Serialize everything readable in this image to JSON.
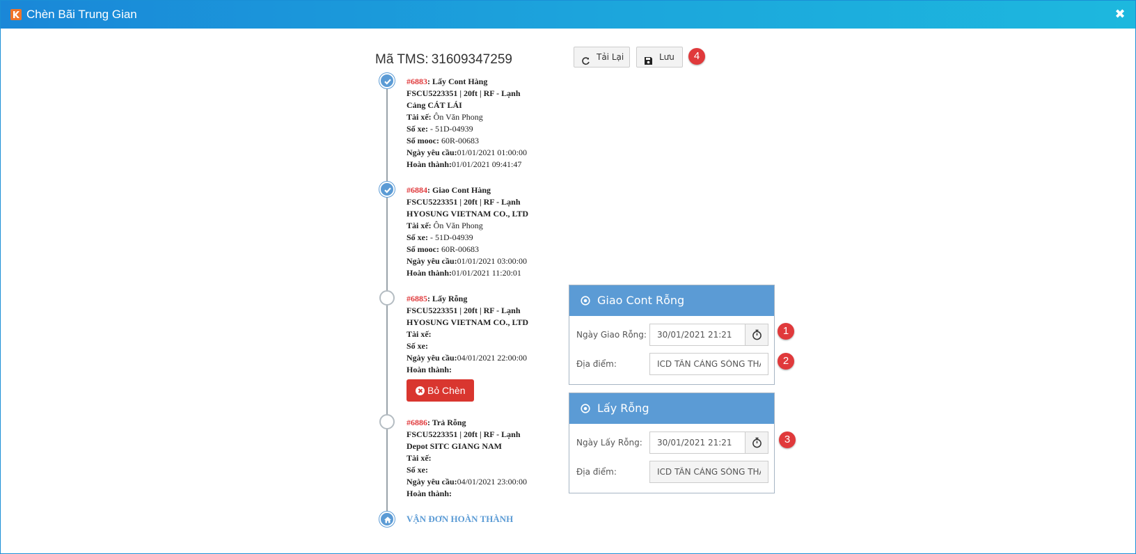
{
  "window": {
    "title": "Chèn Bãi Trung Gian",
    "close_glyph": "✖"
  },
  "tms": {
    "label": "Mã TMS:",
    "value": "31609347259"
  },
  "toolbar": {
    "reload_label": "Tải Lại",
    "save_label": "Lưu",
    "save_badge": "4"
  },
  "stops": [
    {
      "code": "#6883",
      "action": ": Lấy Cont Hàng",
      "container": "FSCU5223351 | 20ft | RF - Lạnh",
      "place": "Cảng CÁT LÁI",
      "driver_label": "Tài xế:",
      "driver_value": " Ôn Văn Phong",
      "truck_label": "Số xe:",
      "truck_value": " - 51D-04939",
      "mooc_label": "Số mooc:",
      "mooc_value": " 60R-00683",
      "request_label": "Ngày yêu cầu:",
      "request_value": "01/01/2021 01:00:00",
      "done_label": "Hoàn thành:",
      "done_value": "01/01/2021 09:41:47",
      "status": "done"
    },
    {
      "code": "#6884",
      "action": ": Giao Cont Hàng",
      "container": "FSCU5223351 | 20ft | RF - Lạnh",
      "place": "HYOSUNG VIETNAM CO., LTD",
      "driver_label": "Tài xế:",
      "driver_value": " Ôn Văn Phong",
      "truck_label": "Số xe:",
      "truck_value": " - 51D-04939",
      "mooc_label": "Số mooc:",
      "mooc_value": " 60R-00683",
      "request_label": "Ngày yêu cầu:",
      "request_value": "01/01/2021 03:00:00",
      "done_label": "Hoàn thành:",
      "done_value": "01/01/2021 11:20:01",
      "status": "done"
    },
    {
      "code": "#6885",
      "action": ": Lấy Rỗng",
      "container": "FSCU5223351 | 20ft | RF - Lạnh",
      "place": "HYOSUNG VIETNAM CO., LTD",
      "driver_label": "Tài xế:",
      "truck_label": "Số xe:",
      "request_label": "Ngày yêu cầu:",
      "request_value": "04/01/2021 22:00:00",
      "done_label": "Hoàn thành:",
      "remove_label": "Bỏ Chèn",
      "status": "pending"
    },
    {
      "code": "#6886",
      "action": ": Trả Rỗng",
      "container": "FSCU5223351 | 20ft | RF - Lạnh",
      "place": "Depot SITC GIANG NAM",
      "driver_label": "Tài xế:",
      "truck_label": "Số xe:",
      "request_label": "Ngày yêu cầu:",
      "request_value": "04/01/2021 23:00:00",
      "done_label": "Hoàn thành:",
      "status": "pending"
    }
  ],
  "completion_label": "VẬN ĐƠN HOÀN THÀNH",
  "panels": {
    "drop": {
      "title": "Giao Cont Rỗng",
      "date_label": "Ngày Giao Rỗng:",
      "date_value": "30/01/2021 21:21",
      "date_badge": "1",
      "place_label": "Địa điểm:",
      "place_value": "ICD TÂN CẢNG SÓNG THẦN",
      "place_badge": "2"
    },
    "pick": {
      "title": "Lấy Rỗng",
      "date_label": "Ngày Lấy Rỗng:",
      "date_value": "30/01/2021 21:21",
      "date_badge": "3",
      "place_label": "Địa điểm:",
      "place_value": "ICD TÂN CẢNG SÓNG THẦN"
    }
  },
  "icons": {
    "app": "k-logo-icon",
    "close": "close-icon",
    "reload": "refresh-icon",
    "save": "floppy-disk-icon",
    "check": "check-icon",
    "home": "home-icon",
    "remove": "x-circle-icon",
    "target": "target-icon",
    "timer": "stopwatch-icon"
  },
  "colors": {
    "titlebar": "#1a87d8",
    "accent": "#5b9bd5",
    "danger": "#d9362f",
    "code_red": "#e0393b"
  }
}
